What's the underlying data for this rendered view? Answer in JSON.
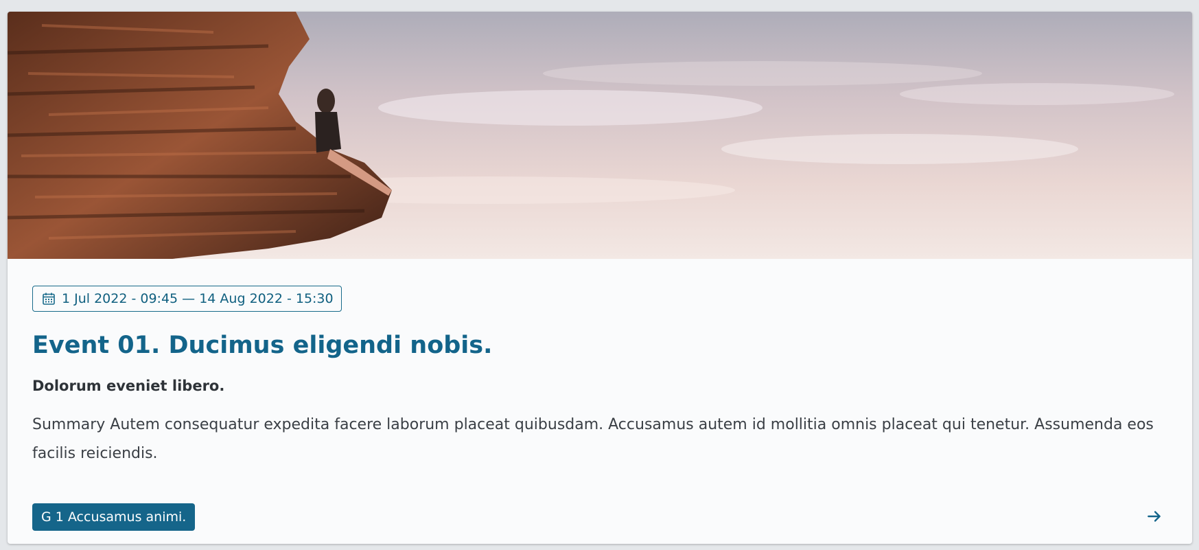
{
  "card": {
    "image_alt": "Person sitting on a rocky cliff edge at sunset",
    "date_icon": "calendar-icon",
    "date_range": "1 Jul 2022 - 09:45 — 14 Aug 2022 - 15:30",
    "title": "Event 01. Ducimus eligendi nobis.",
    "subtitle": "Dolorum eveniet libero.",
    "summary": "Summary Autem consequatur expedita facere laborum placeat quibusdam. Accusamus autem id mollitia omnis placeat qui tenetur. Assumenda eos facilis reiciendis.",
    "tag": "G 1 Accusamus animi.",
    "link_icon": "arrow-right-icon"
  },
  "colors": {
    "accent": "#13648a",
    "tag_bg": "#15658a",
    "text": "#3a3f45",
    "card_bg": "#fafbfc"
  }
}
